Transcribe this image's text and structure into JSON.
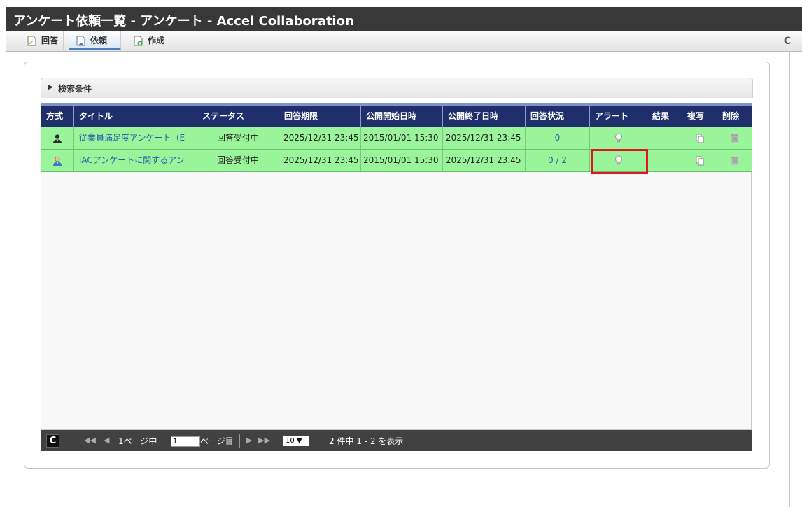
{
  "window": {
    "title": "アンケート依頼一覧 - アンケート - Accel Collaboration"
  },
  "toolbar": {
    "tabs": [
      {
        "label": "回答"
      },
      {
        "label": "依頼"
      },
      {
        "label": "作成"
      }
    ],
    "refresh_icon": "refresh-icon"
  },
  "search": {
    "label": "検索条件"
  },
  "table": {
    "headers": [
      "方式",
      "タイトル",
      "ステータス",
      "回答期限",
      "公開開始日時",
      "公開終了日時",
      "回答状況",
      "アラート",
      "結果",
      "複写",
      "削除"
    ],
    "rows": [
      {
        "method_icon": "person-dark-icon",
        "title": "従業員満足度アンケート（E",
        "status": "回答受付中",
        "deadline": "2025/12/31 23:45",
        "start": "2015/01/01 15:30",
        "end": "2025/12/31 23:45",
        "answer_status": "0",
        "alert_icon": "bulb-icon",
        "copy_icon": "copy-icon",
        "delete_icon": "trash-icon"
      },
      {
        "method_icon": "person-color-icon",
        "title": "iACアンケートに関するアン",
        "status": "回答受付中",
        "deadline": "2025/12/31 23:45",
        "start": "2015/01/01 15:30",
        "end": "2025/12/31 23:45",
        "answer_status": "0 / 2",
        "alert_icon": "bulb-icon",
        "copy_icon": "copy-icon",
        "delete_icon": "trash-icon"
      }
    ]
  },
  "pager": {
    "page_prefix": "1ページ中",
    "page_value": "1",
    "page_suffix": "ページ目",
    "per_page": "10 ▼",
    "summary": "2 件中 1 - 2 を表示"
  },
  "colors": {
    "row_bg": "#9af59a",
    "header_bg": "#1e2f6b",
    "link": "#2a5db0",
    "highlight": "#e0171e"
  }
}
